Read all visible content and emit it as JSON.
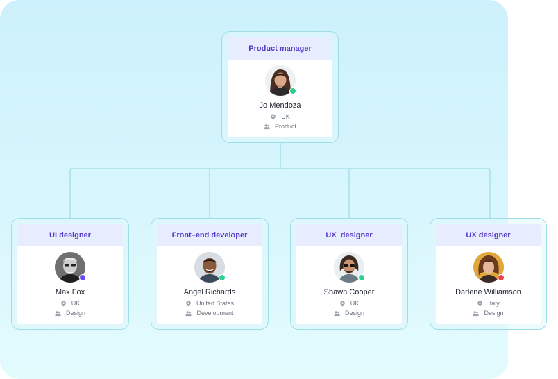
{
  "colors": {
    "header_bg": "#e8ecff",
    "header_text": "#5538c9",
    "connector": "#8fd6de",
    "status_online": "#2ecf8f",
    "status_busy": "#6a4cf2",
    "status_offline": "#ef4444"
  },
  "root": {
    "role": "Product manager",
    "name": "Jo Mendoza",
    "location": "UK",
    "team": "Product",
    "status_color": "#2ecf8f",
    "location_icon": "location-pin-icon",
    "team_icon": "people-icon"
  },
  "reports": [
    {
      "role": "UI designer",
      "name": "Max Fox",
      "location": "UK",
      "team": "Design",
      "status_color": "#6a4cf2"
    },
    {
      "role": "Front–end developer",
      "name": "Angel Richards",
      "location": "United States",
      "team": "Development",
      "status_color": "#2ecf8f"
    },
    {
      "role": "UX  designer",
      "name": "Shawn Cooper",
      "location": "UK",
      "team": "Design",
      "status_color": "#2ecf8f"
    },
    {
      "role": "UX designer",
      "name": "Darlene Williamson",
      "location": "Italy",
      "team": "Design",
      "status_color": "#ef4444"
    }
  ]
}
